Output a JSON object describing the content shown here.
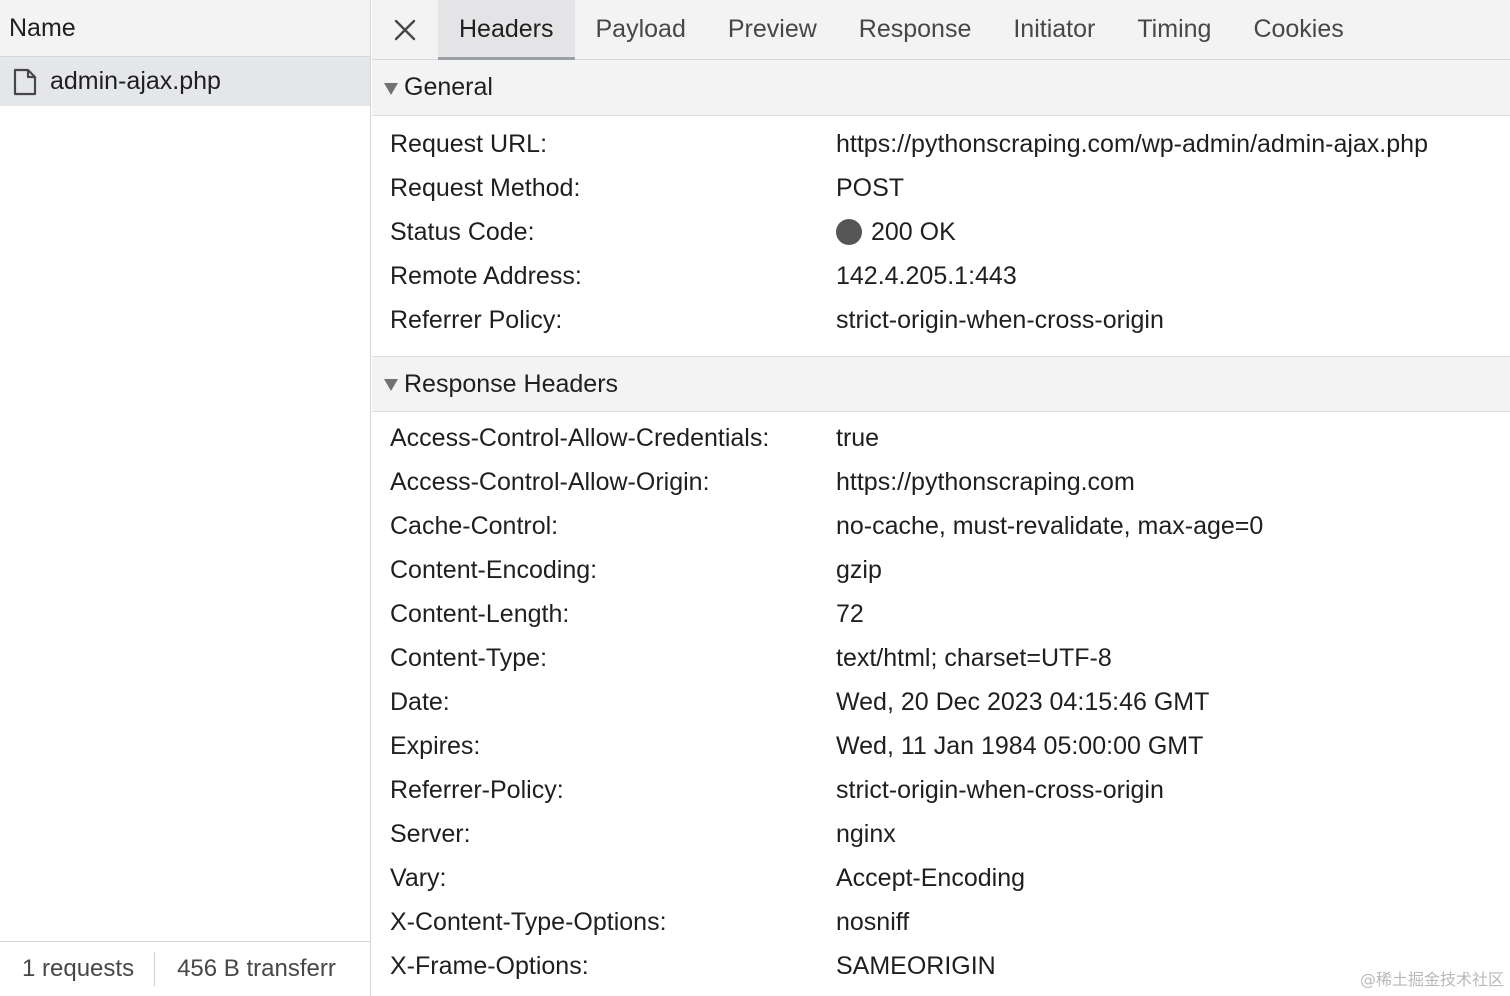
{
  "left": {
    "name_header": "Name",
    "request": {
      "name": "admin-ajax.php",
      "icon": "file-icon"
    },
    "status_bar": {
      "requests": "1 requests",
      "transferred": "456 B transferr"
    }
  },
  "tabs": [
    {
      "label": "Headers",
      "active": true
    },
    {
      "label": "Payload"
    },
    {
      "label": "Preview"
    },
    {
      "label": "Response"
    },
    {
      "label": "Initiator"
    },
    {
      "label": "Timing"
    },
    {
      "label": "Cookies"
    }
  ],
  "general": {
    "title": "General",
    "rows": [
      {
        "key": "Request URL:",
        "value": "https://pythonscraping.com/wp-admin/admin-ajax.php"
      },
      {
        "key": "Request Method:",
        "value": "POST"
      },
      {
        "key": "Status Code:",
        "value": "200 OK",
        "dot_color": "#555555"
      },
      {
        "key": "Remote Address:",
        "value": "142.4.205.1:443"
      },
      {
        "key": "Referrer Policy:",
        "value": "strict-origin-when-cross-origin"
      }
    ]
  },
  "response_headers": {
    "title": "Response Headers",
    "rows": [
      {
        "key": "Access-Control-Allow-Credentials:",
        "value": "true"
      },
      {
        "key": "Access-Control-Allow-Origin:",
        "value": "https://pythonscraping.com"
      },
      {
        "key": "Cache-Control:",
        "value": "no-cache, must-revalidate, max-age=0"
      },
      {
        "key": "Content-Encoding:",
        "value": "gzip"
      },
      {
        "key": "Content-Length:",
        "value": "72"
      },
      {
        "key": "Content-Type:",
        "value": "text/html; charset=UTF-8"
      },
      {
        "key": "Date:",
        "value": "Wed, 20 Dec 2023 04:15:46 GMT"
      },
      {
        "key": "Expires:",
        "value": "Wed, 11 Jan 1984 05:00:00 GMT"
      },
      {
        "key": "Referrer-Policy:",
        "value": "strict-origin-when-cross-origin"
      },
      {
        "key": "Server:",
        "value": "nginx"
      },
      {
        "key": "Vary:",
        "value": "Accept-Encoding"
      },
      {
        "key": "X-Content-Type-Options:",
        "value": "nosniff"
      },
      {
        "key": "X-Frame-Options:",
        "value": "SAMEORIGIN"
      }
    ]
  },
  "watermark": "@稀土掘金技术社区",
  "colors": {
    "accent_underline": "#9aa0a6",
    "selected_row": "#e4e6ea",
    "status_dot": "#555555"
  }
}
